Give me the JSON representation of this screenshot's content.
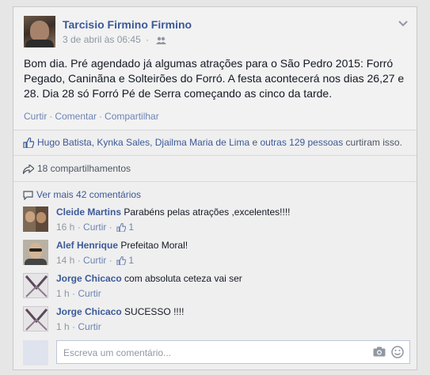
{
  "post": {
    "author": "Tarcisio Firmino Firmino",
    "date": "3 de abril às 06:45",
    "privacy_icon": "friends-icon",
    "text": "Bom dia. Pré agendado já algumas atrações para o São Pedro 2015: Forró Pegado, Caninãna e Solteirões do Forró. A festa acontecerá nos dias 26,27 e 28. Dia 28 só Forró Pé de Serra começando as cinco da tarde.",
    "actions": {
      "like": "Curtir",
      "comment": "Comentar",
      "share": "Compartilhar"
    }
  },
  "likes": {
    "names": "Hugo Batista, Kynka Sales, Djailma Maria de Lima",
    "connector": " e ",
    "others": "outras 129 pessoas",
    "suffix": " curtiram isso."
  },
  "shares": {
    "text": "18 compartilhamentos"
  },
  "more_comments": {
    "text": "Ver mais 42 comentários"
  },
  "comments": [
    {
      "name": "Cleide Martins",
      "text": "Parabéns pelas atrações ,excelentes!!!!",
      "time": "16 h",
      "like": "Curtir",
      "likes": "1"
    },
    {
      "name": "Alef Henrique",
      "text": "Prefeitao Moral!",
      "time": "14 h",
      "like": "Curtir",
      "likes": "1"
    },
    {
      "name": "Jorge Chicaco",
      "text": "com absoluta ceteza vai ser",
      "time": "1 h",
      "like": "Curtir",
      "likes": ""
    },
    {
      "name": "Jorge Chicaco",
      "text": "SUCESSO !!!!",
      "time": "1 h",
      "like": "Curtir",
      "likes": ""
    }
  ],
  "composer": {
    "placeholder": "Escreva um comentário..."
  },
  "colors": {
    "link": "#3b5998",
    "muted": "#9197a3",
    "background": "#efefef"
  }
}
